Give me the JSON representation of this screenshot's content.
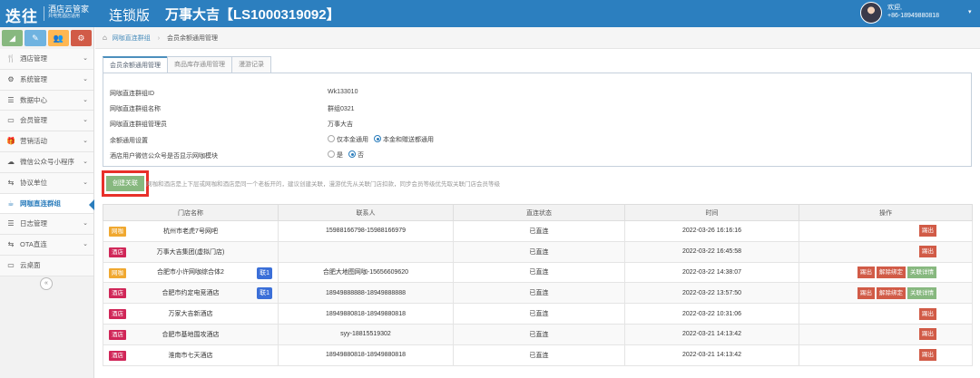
{
  "header": {
    "logo": "迭往",
    "logo_sub": "酒店云管家",
    "logo_sub_small": "共电竞酒店适用",
    "edition": "连锁版",
    "hotel_title": "万事大吉【LS1000319092】",
    "welcome": "欢迎,",
    "user_phone": "+86-18949880818",
    "caret": "▾"
  },
  "quick_buttons": [
    "◢",
    "✎",
    "👥",
    "⚙"
  ],
  "sidebar": {
    "items": [
      {
        "label": "酒店管理",
        "icon": "🍴"
      },
      {
        "label": "系统管理",
        "icon": "⚙"
      },
      {
        "label": "数据中心",
        "icon": "☰"
      },
      {
        "label": "会员管理",
        "icon": "▭"
      },
      {
        "label": "营销活动",
        "icon": "🎁"
      },
      {
        "label": "微信公众号小程序",
        "icon": "☁"
      },
      {
        "label": "协议单位",
        "icon": "⇆"
      },
      {
        "label": "网咖直连群组",
        "icon": "☕"
      },
      {
        "label": "日志管理",
        "icon": "☰"
      },
      {
        "label": "OTA直连",
        "icon": "⇆"
      },
      {
        "label": "云桌面",
        "icon": "▭"
      }
    ],
    "collapse": "«"
  },
  "breadcrumb": {
    "home_icon": "⌂",
    "item1": "网咖直连群组",
    "sep": "›",
    "item2": "会员余额通用管理"
  },
  "tabs": [
    "会员余额通用管理",
    "商品库存通用管理",
    "漫游记录"
  ],
  "info": {
    "group_id_label": "网咖直连群组ID",
    "group_id": "Wk133010",
    "group_name_label": "网咖直连群组名称",
    "group_name": "群组0321",
    "admin_label": "网咖直连群组管理员",
    "admin": "万事大吉",
    "balance_label": "余额通用设置",
    "balance_opt1": "仅本金通用",
    "balance_opt2": "本金和赠送都通用",
    "wechat_label": "酒店用户微信公众号是否显示网咖模块",
    "wechat_opt1": "是",
    "wechat_opt2": "否"
  },
  "create_button": "创建关联",
  "hint": "网咖和酒店是上下层或网咖和酒店是同一个老板开的，建议创建关联，漫游优先从关联门店扣款，同步会员等级优先取关联门店会员等级",
  "table": {
    "headers": [
      "门店名称",
      "联系人",
      "直连状态",
      "时间",
      "操作"
    ],
    "rows": [
      {
        "tag": "网咖",
        "tag_type": "cafe",
        "store": "杭州市老虎7号网吧",
        "link": "",
        "contact": "15988166798-15988166979",
        "status": "已直连",
        "time": "2022-03-26 16:16:16",
        "ops": [
          "踢出"
        ]
      },
      {
        "tag": "酒店",
        "tag_type": "hotel",
        "store": "万事大吉集团(虚拟门店)",
        "link": "",
        "contact": "",
        "status": "已直连",
        "time": "2022-03-22 16:45:58",
        "ops": [
          "踢出"
        ]
      },
      {
        "tag": "网咖",
        "tag_type": "cafe",
        "store": "合肥市小许网咖综合体2",
        "link": "联1",
        "contact": "合肥大地图网咖-15656609620",
        "status": "已直连",
        "time": "2022-03-22 14:38:07",
        "ops": [
          "踢出",
          "解除绑定",
          "关联详情"
        ]
      },
      {
        "tag": "酒店",
        "tag_type": "hotel",
        "store": "合肥市约定电竞酒店",
        "link": "联1",
        "contact": "18949888888-18949888888",
        "status": "已直连",
        "time": "2022-03-22 13:57:50",
        "ops": [
          "踢出",
          "解除绑定",
          "关联详情"
        ]
      },
      {
        "tag": "酒店",
        "tag_type": "hotel",
        "store": "万家大吉新酒店",
        "link": "",
        "contact": "18949880818-18949880818",
        "status": "已直连",
        "time": "2022-03-22 10:31:06",
        "ops": [
          "踢出"
        ]
      },
      {
        "tag": "酒店",
        "tag_type": "hotel",
        "store": "合肥市基地围攻酒店",
        "link": "",
        "contact": "syy-18815519302",
        "status": "已直连",
        "time": "2022-03-21 14:13:42",
        "ops": [
          "踢出"
        ]
      },
      {
        "tag": "酒店",
        "tag_type": "hotel",
        "store": "淮南市七天酒店",
        "link": "",
        "contact": "18949880818-18949880818",
        "status": "已直连",
        "time": "2022-03-21 14:13:42",
        "ops": [
          "踢出"
        ]
      }
    ]
  }
}
